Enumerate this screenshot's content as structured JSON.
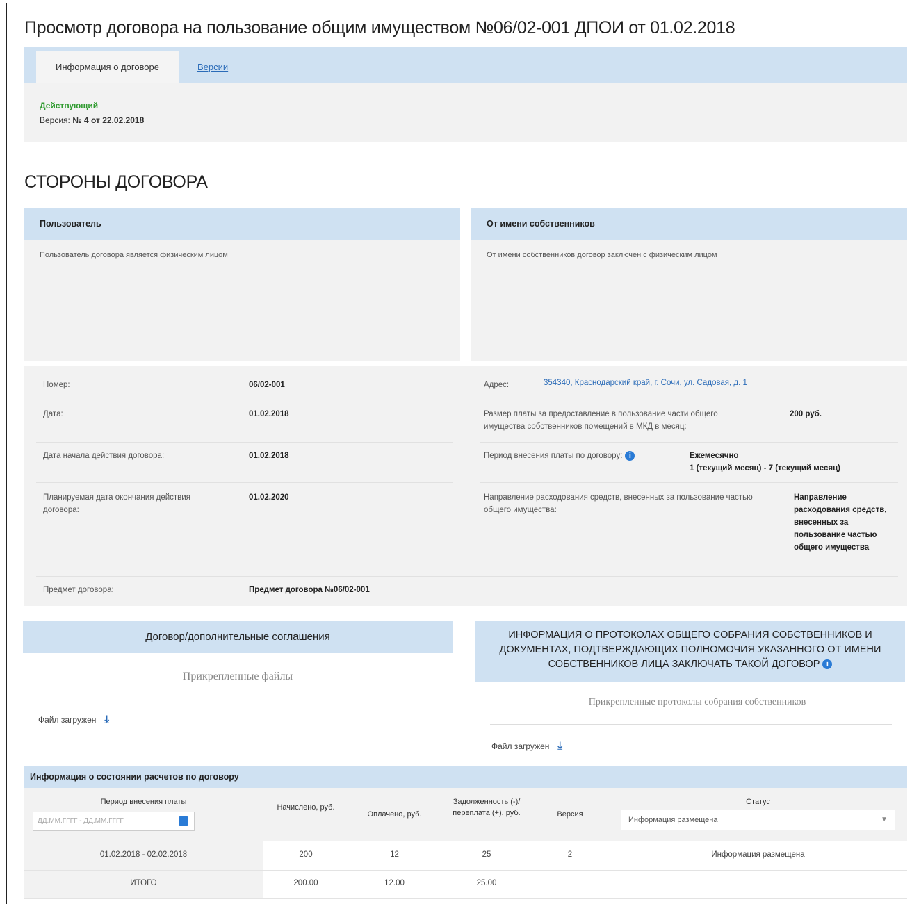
{
  "page": {
    "title": "Просмотр договора на пользование общим имуществом №06/02-001 ДПОИ от 01.02.2018",
    "tabs": [
      {
        "label": "Информация о договоре"
      },
      {
        "label": "Версии"
      }
    ],
    "status": {
      "state": "Действующий",
      "version_label": "Версия:",
      "version_value": "№ 4 от 22.02.2018"
    },
    "colors": {
      "accent_blue": "#cfe1f2",
      "link": "#2a6bb8",
      "active_green": "#2e9a2e"
    }
  },
  "parties": {
    "section_title": "СТОРОНЫ ДОГОВОРА",
    "user": {
      "header": "Пользователь",
      "text": "Пользователь договора является физическим лицом"
    },
    "owners": {
      "header": "От имени собственников",
      "text": "От имени собственников договор заключен с физическим лицом"
    }
  },
  "details": {
    "left": [
      {
        "label": "Номер:",
        "value": "06/02-001"
      },
      {
        "label": "Дата:",
        "value": "01.02.2018"
      },
      {
        "label": "Дата начала действия договора:",
        "value": "01.02.2018"
      },
      {
        "label": "Планируемая дата окончания действия договора:",
        "value": "01.02.2020"
      },
      {
        "label": "Предмет договора:",
        "value": "Предмет договора №06/02-001"
      }
    ],
    "address_label": "Адрес:",
    "address_value": "354340, Краснодарский край, г. Сочи, ул. Садовая, д. 1",
    "fee_label": "Размер платы за предоставление в пользование части общего имущества собственников помещений в МКД в месяц:",
    "fee_value": "200 руб.",
    "period_label": "Период внесения платы по договору:",
    "period_value_1": "Ежемесячно",
    "period_value_2": "1 (текущий месяц) - 7 (текущий месяц)",
    "direction_label": "Направление расходования средств, внесенных за пользование частью общего имущества:",
    "direction_value": "Направление расходования средств, внесенных за пользование частью общего имущества"
  },
  "attachments": {
    "contract_header": "Договор/дополнительные соглашения",
    "contract_caption": "Прикрепленные файлы",
    "contract_upload": "Файл загружен",
    "protocols_header": "ИНФОРМАЦИЯ О ПРОТОКОЛАХ ОБЩЕГО СОБРАНИЯ СОБСТВЕННИКОВ И ДОКУМЕНТАХ, ПОДТВЕРЖДАЮЩИХ ПОЛНОМОЧИЯ УКАЗАННОГО ОТ ИМЕНИ СОБСТВЕННИКОВ ЛИЦА ЗАКЛЮЧАТЬ ТАКОЙ ДОГОВОР",
    "protocols_caption": "Прикрепленные протоколы собрания собственников",
    "protocols_upload": "Файл загружен"
  },
  "settlements": {
    "title": "Информация о состоянии расчетов по договору",
    "columns": {
      "period": "Период внесения платы",
      "accrued": "Начислено, руб.",
      "paid": "Оплачено, руб.",
      "debt": "Задолженность (-)/ переплата (+), руб.",
      "version": "Версия",
      "status": "Статус"
    },
    "period_placeholder": "ДД.ММ.ГГГГ - ДД.ММ.ГГГГ",
    "status_filter": "Информация размещена",
    "rows": [
      {
        "period": "01.02.2018 - 02.02.2018",
        "accrued": "200",
        "paid": "12",
        "debt": "25",
        "version": "2",
        "status": "Информация размещена"
      }
    ],
    "total": {
      "label": "ИТОГО",
      "accrued": "200.00",
      "paid": "12.00",
      "debt": "25.00"
    }
  }
}
